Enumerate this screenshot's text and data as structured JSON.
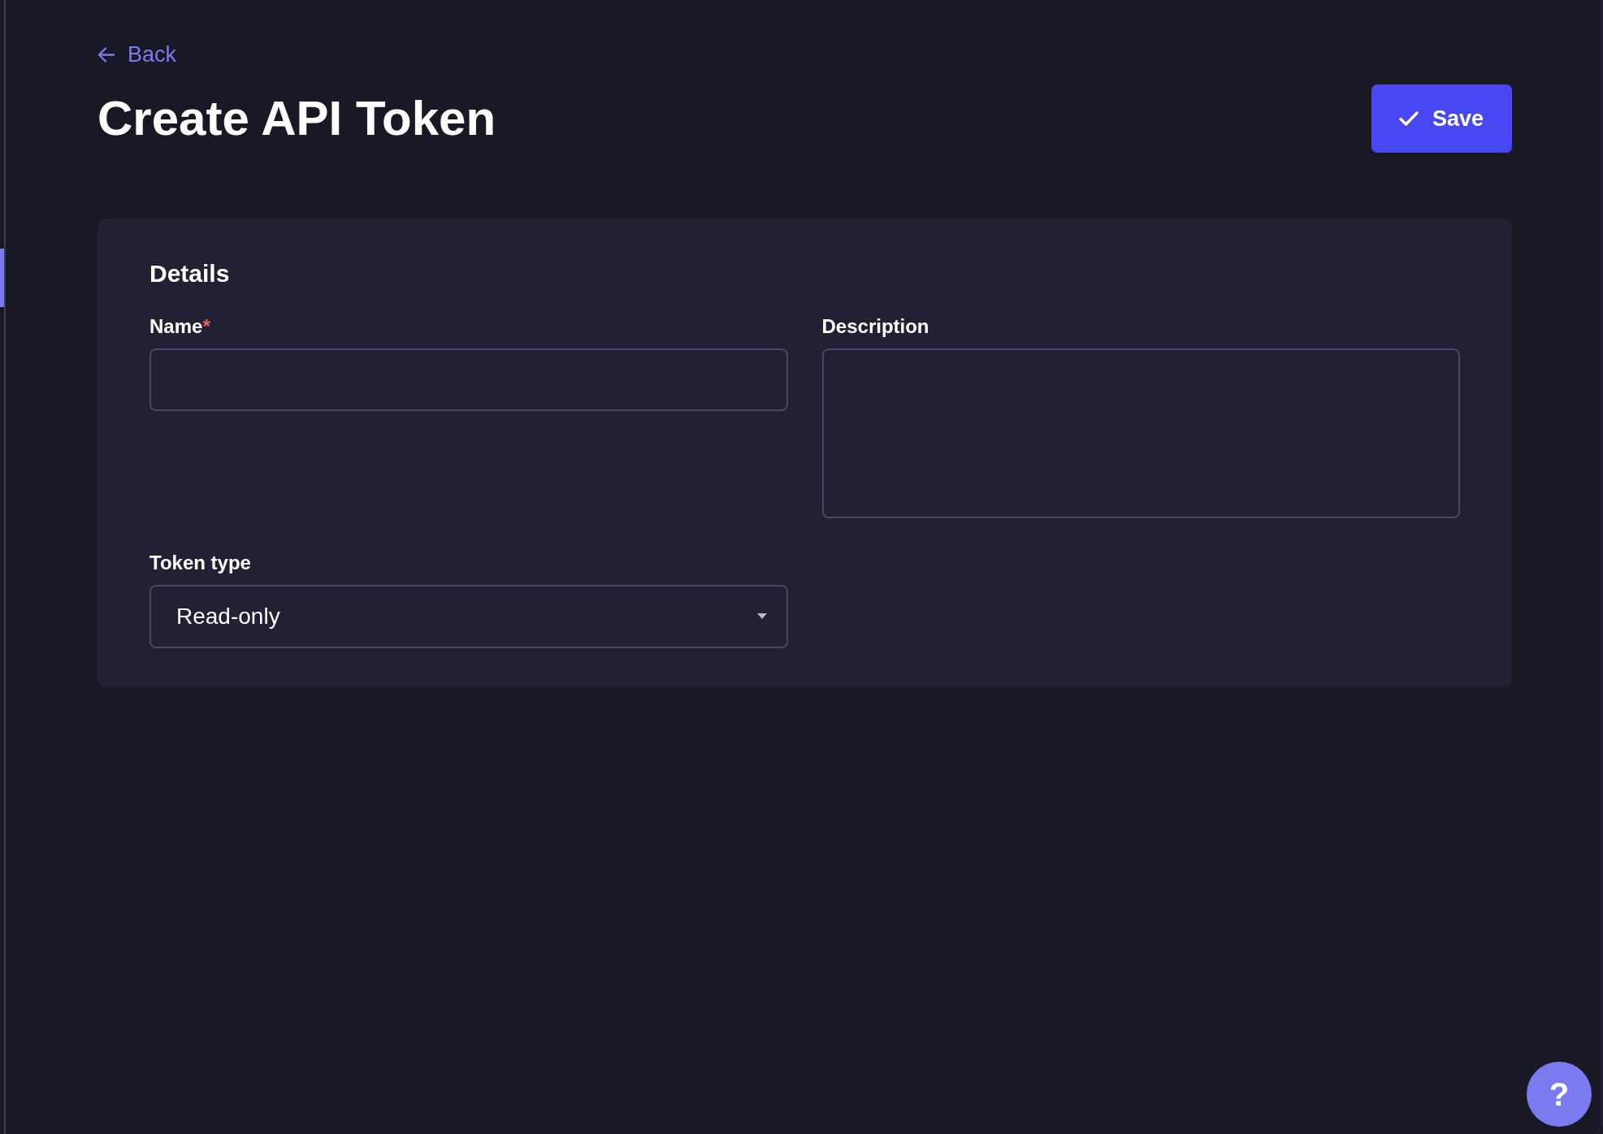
{
  "back_link": {
    "label": "Back"
  },
  "page_title": "Create API Token",
  "save_button": {
    "label": "Save"
  },
  "details_card": {
    "heading": "Details",
    "fields": [
      {
        "kind": "text",
        "label": "Name",
        "required_mark": "*"
      },
      {
        "kind": "textarea",
        "label": "Description"
      },
      {
        "kind": "select",
        "label": "Token type",
        "value": "Read-only"
      }
    ]
  },
  "help_button": {
    "label": "?"
  }
}
